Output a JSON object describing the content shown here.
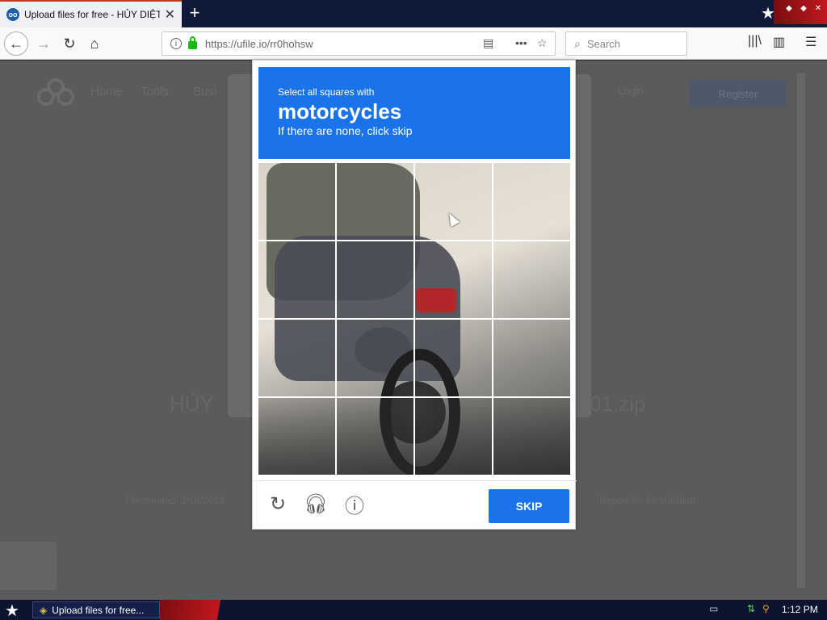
{
  "browser": {
    "tab_title": "Upload files for free - HỦY DIỆT M",
    "url": "https://ufile.io/rr0hohsw",
    "search_placeholder": "Search",
    "new_tab": "+",
    "close_tab": "✕"
  },
  "page": {
    "nav": [
      "Home",
      "Tools",
      "Busi"
    ],
    "login": "Login",
    "register": "Register",
    "big_left": "HỦY",
    "big_right": "01.zip",
    "footer_left": "File created: 1/19/2024",
    "footer_right": "Report file for violation"
  },
  "captcha": {
    "instruction": "Select all squares with",
    "target": "motorcycles",
    "hint": "If there are none, click skip",
    "skip_label": "SKIP",
    "grid_rows": 4,
    "grid_cols": 4
  },
  "taskbar": {
    "task_label": "Upload files for free...",
    "clock": "1:12 PM"
  }
}
